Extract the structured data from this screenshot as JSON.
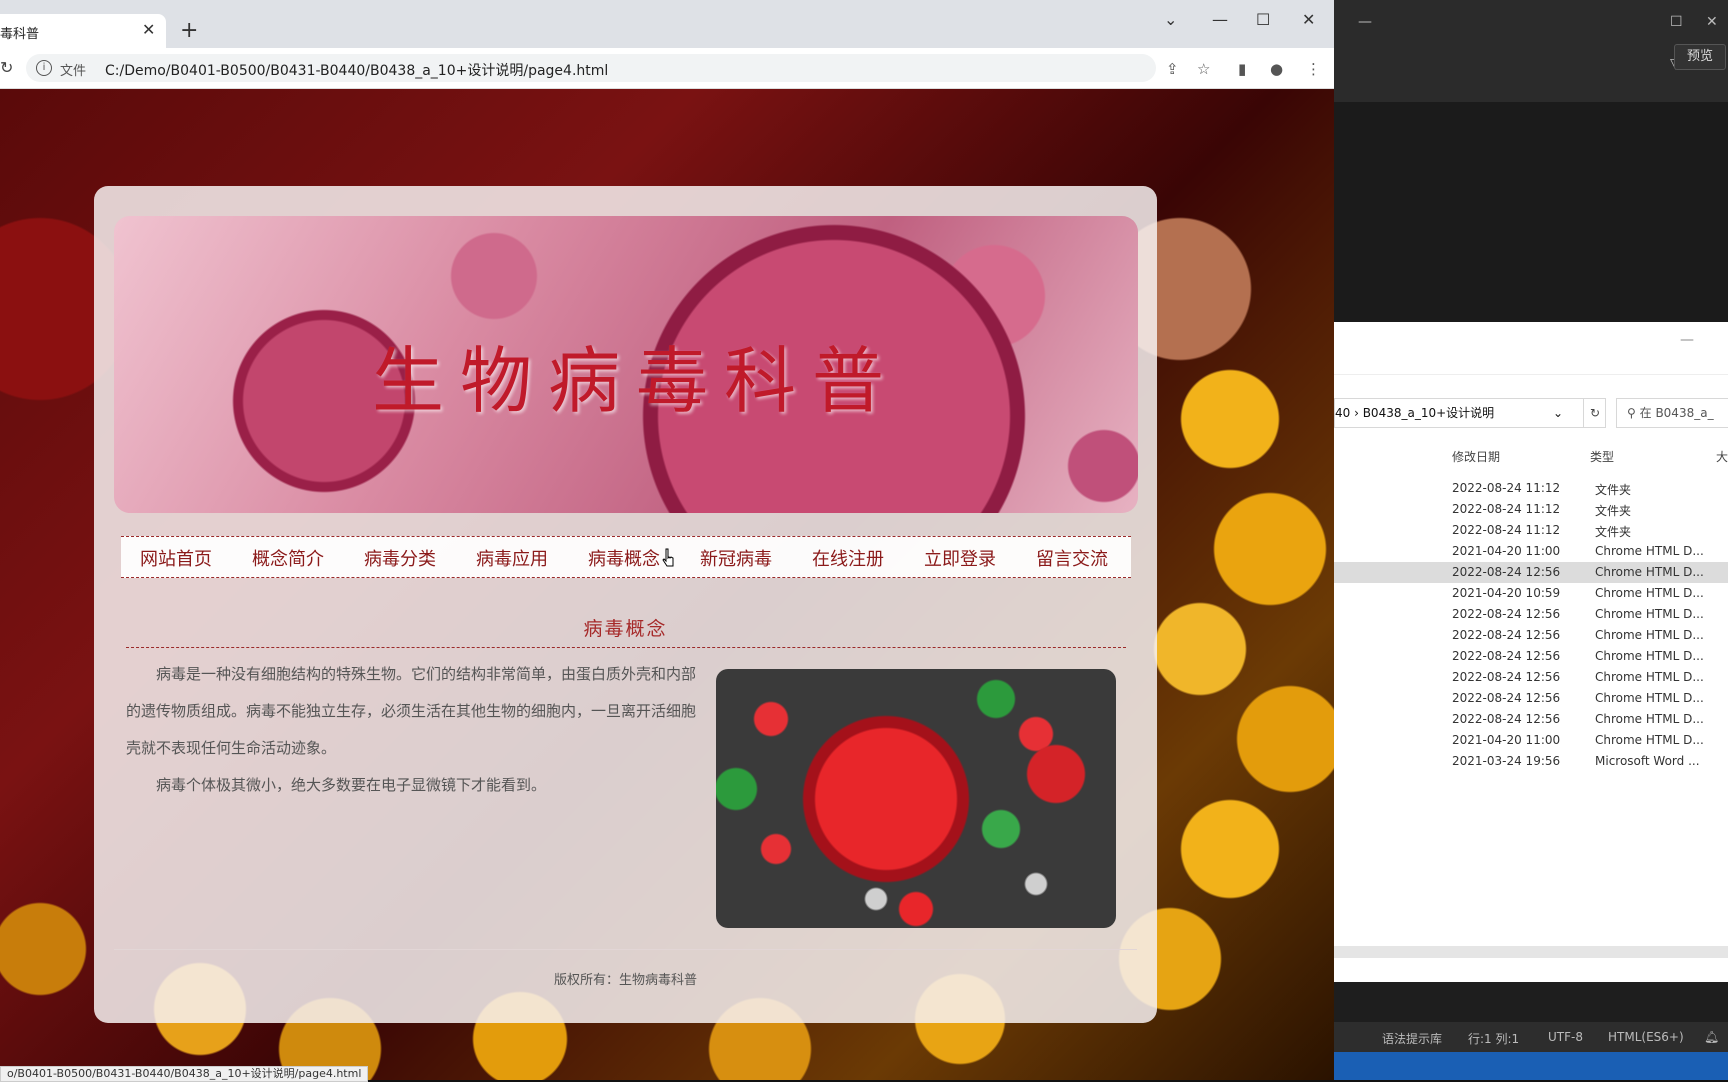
{
  "browser": {
    "tab_title": "毒科普",
    "new_tab": "+",
    "file_label": "文件",
    "url": "C:/Demo/B0401-B0500/B0431-B0440/B0438_a_10+设计说明/page4.html",
    "status_url": "o/B0401-B0500/B0431-B0440/B0438_a_10+设计说明/page4.html"
  },
  "page": {
    "banner_title": "生物病毒科普",
    "nav": [
      "网站首页",
      "概念简介",
      "病毒分类",
      "病毒应用",
      "病毒概念",
      "新冠病毒",
      "在线注册",
      "立即登录",
      "留言交流"
    ],
    "section_title": "病毒概念",
    "paragraphs": [
      "病毒是一种没有细胞结构的特殊生物。它们的结构非常简单，由蛋白质外壳和内部的遗传物质组成。病毒不能独立生存，必须生活在其他生物的细胞内，一旦离开活细胞壳就不表现任何生命活动迹象。",
      "病毒个体极其微小，绝大多数要在电子显微镜下才能看到。"
    ],
    "footer": "版权所有：生物病毒科普"
  },
  "editor": {
    "preview_button": "预览",
    "status": {
      "hint": "语法提示库",
      "position": "行:1  列:1",
      "encoding": "UTF-8",
      "mode": "HTML(ES6+)"
    }
  },
  "explorer": {
    "breadcrumb": "40  ›  B0438_a_10+设计说明",
    "search_placeholder": "在 B0438_a_",
    "columns": {
      "date": "修改日期",
      "type": "类型",
      "size": "大"
    },
    "rows": [
      {
        "date": "2022-08-24 11:12",
        "type": "文件夹"
      },
      {
        "date": "2022-08-24 11:12",
        "type": "文件夹"
      },
      {
        "date": "2022-08-24 11:12",
        "type": "文件夹"
      },
      {
        "date": "2021-04-20 11:00",
        "type": "Chrome HTML D..."
      },
      {
        "date": "2022-08-24 12:56",
        "type": "Chrome HTML D..."
      },
      {
        "date": "2021-04-20 10:59",
        "type": "Chrome HTML D..."
      },
      {
        "date": "2022-08-24 12:56",
        "type": "Chrome HTML D..."
      },
      {
        "date": "2022-08-24 12:56",
        "type": "Chrome HTML D..."
      },
      {
        "date": "2022-08-24 12:56",
        "type": "Chrome HTML D..."
      },
      {
        "date": "2022-08-24 12:56",
        "type": "Chrome HTML D..."
      },
      {
        "date": "2022-08-24 12:56",
        "type": "Chrome HTML D..."
      },
      {
        "date": "2022-08-24 12:56",
        "type": "Chrome HTML D..."
      },
      {
        "date": "2021-04-20 11:00",
        "type": "Chrome HTML D..."
      },
      {
        "date": "2021-03-24 19:56",
        "type": "Microsoft Word ..."
      }
    ],
    "selected_row": 4
  },
  "colors": {
    "accent": "#8b1a1a",
    "title": "#c01a2a"
  }
}
